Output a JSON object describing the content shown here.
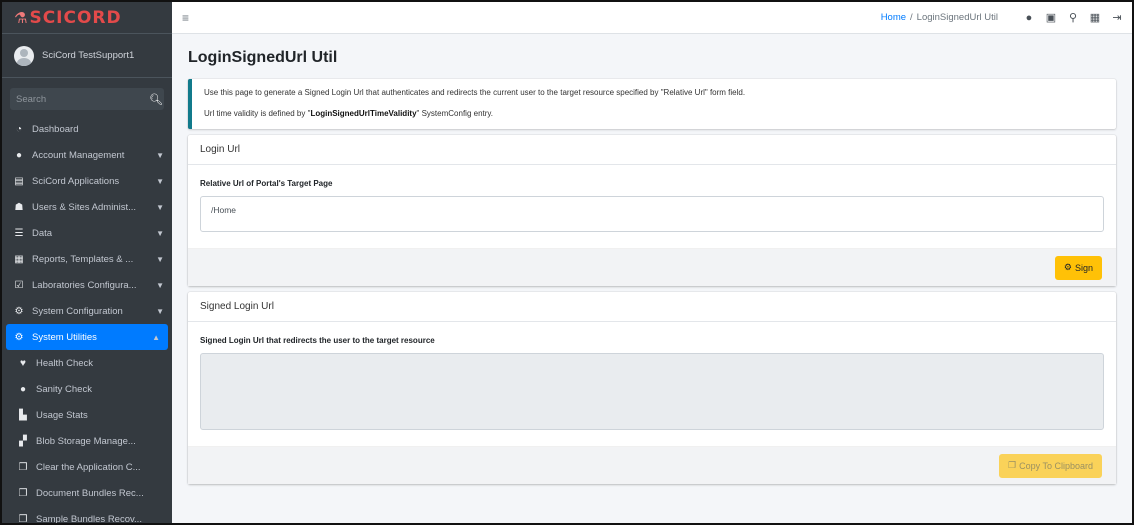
{
  "brand": {
    "name": "SCICORD"
  },
  "user": {
    "name": "SciCord TestSupport1"
  },
  "sidebar": {
    "search_placeholder": "Search",
    "items": [
      {
        "label": "Dashboard",
        "icon": "dashboard-icon"
      },
      {
        "label": "Account Management",
        "icon": "user-circle-icon"
      },
      {
        "label": "SciCord Applications",
        "icon": "apps-icon"
      },
      {
        "label": "Users & Sites Administ...",
        "icon": "users-icon"
      },
      {
        "label": "Data",
        "icon": "database-icon"
      },
      {
        "label": "Reports, Templates & ...",
        "icon": "table-icon"
      },
      {
        "label": "Laboratories Configura...",
        "icon": "clipboard-check-icon"
      },
      {
        "label": "System Configuration",
        "icon": "cogs-icon"
      },
      {
        "label": "System Utilities",
        "icon": "gear-icon"
      }
    ],
    "subitems": [
      {
        "label": "Health Check",
        "icon": "heartbeat-icon"
      },
      {
        "label": "Sanity Check",
        "icon": "brain-icon"
      },
      {
        "label": "Usage Stats",
        "icon": "chart-icon"
      },
      {
        "label": "Blob Storage Manage...",
        "icon": "boxes-icon"
      },
      {
        "label": "Clear the Application C...",
        "icon": "copy-icon"
      },
      {
        "label": "Document Bundles Rec...",
        "icon": "copy-icon"
      },
      {
        "label": "Sample Bundles Recov...",
        "icon": "copy-icon"
      }
    ]
  },
  "breadcrumb": {
    "home": "Home",
    "separator": "/",
    "current": "LoginSignedUrl Util"
  },
  "page": {
    "title": "LoginSignedUrl Util",
    "info_line1": "Use this page to generate a Signed Login Url that authenticates and redirects the current user to the target resource specified by \"Relative Url\" form field.",
    "info_line2_prefix": "Url time validity is defined by \"",
    "info_line2_key": "LoginSignedUrlTimeValidity",
    "info_line2_suffix": "\" SystemConfig entry."
  },
  "login_card": {
    "header": "Login Url",
    "field_label": "Relative Url of Portal's Target Page",
    "field_value": "/Home",
    "button": "Sign"
  },
  "signed_card": {
    "header": "Signed Login Url",
    "field_label": "Signed Login Url that redirects the user to the target resource",
    "field_value": "",
    "button": "Copy To Clipboard"
  },
  "colors": {
    "sidebar_bg": "#343a40",
    "accent": "#007bff",
    "warning": "#ffc107",
    "brand": "#e34a4a",
    "callout_border": "#117a8b"
  }
}
